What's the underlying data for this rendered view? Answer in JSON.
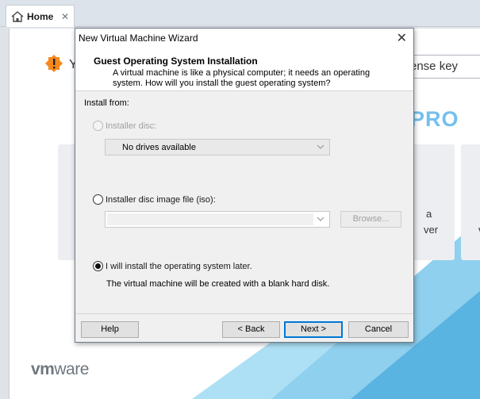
{
  "tab": {
    "label": "Home",
    "close": "✕"
  },
  "home": {
    "warning_fragment": "Y",
    "license_fragment": "ense key",
    "pro_fragment": "PRO",
    "card_fragment_1": "a",
    "card_fragment_2": "ver",
    "card_fragment_3": "v",
    "logo_vm": "vm",
    "logo_ware": "ware"
  },
  "dialog": {
    "title": "New Virtual Machine Wizard",
    "close": "✕",
    "header_title": "Guest Operating System Installation",
    "header_desc": "A virtual machine is like a physical computer; it needs an operating system. How will you install the guest operating system?",
    "install_from": "Install from:",
    "options": {
      "disc": {
        "label": "Installer disc:",
        "selected_drive": "No drives available",
        "selected": false,
        "enabled": false
      },
      "iso": {
        "label": "Installer disc image file (iso):",
        "path_value": "",
        "selected": false,
        "browse": "Browse..."
      },
      "later": {
        "label": "I will install the operating system later.",
        "desc": "The virtual machine will be created with a blank hard disk.",
        "selected": true
      }
    },
    "buttons": {
      "help": "Help",
      "back": "< Back",
      "next": "Next >",
      "cancel": "Cancel"
    }
  },
  "colors": {
    "accent_blue": "#0078d7",
    "pro_blue": "#74c0ec",
    "warning_orange": "#f5891f",
    "field_blue": "#8fd0ee"
  }
}
